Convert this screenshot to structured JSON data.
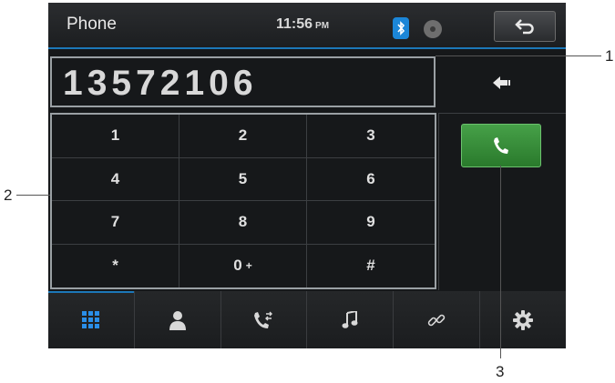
{
  "status_bar": {
    "title": "Phone",
    "time": "11:56",
    "ampm": "PM",
    "icons": [
      "bluetooth-icon",
      "disc-icon"
    ],
    "back_icon": "back-arrow-icon"
  },
  "dialer": {
    "number": "13572106",
    "backspace_icon": "backspace-icon",
    "keys": [
      "1",
      "2",
      "3",
      "4",
      "5",
      "6",
      "7",
      "8",
      "9",
      "*",
      "0",
      "#"
    ],
    "zero_suffix": "+",
    "call_icon": "phone-call-icon"
  },
  "tab_bar": {
    "tabs": [
      {
        "icon": "keypad-icon",
        "active": true
      },
      {
        "icon": "contacts-icon",
        "active": false
      },
      {
        "icon": "call-history-icon",
        "active": false
      },
      {
        "icon": "music-icon",
        "active": false
      },
      {
        "icon": "link-icon",
        "active": false
      },
      {
        "icon": "settings-icon",
        "active": false
      }
    ]
  },
  "callouts": {
    "one": "1",
    "two": "2",
    "three": "3"
  },
  "colors": {
    "accent": "#1c78b8",
    "call_green": "#3a9a3c",
    "screen_bg": "#16181a"
  }
}
